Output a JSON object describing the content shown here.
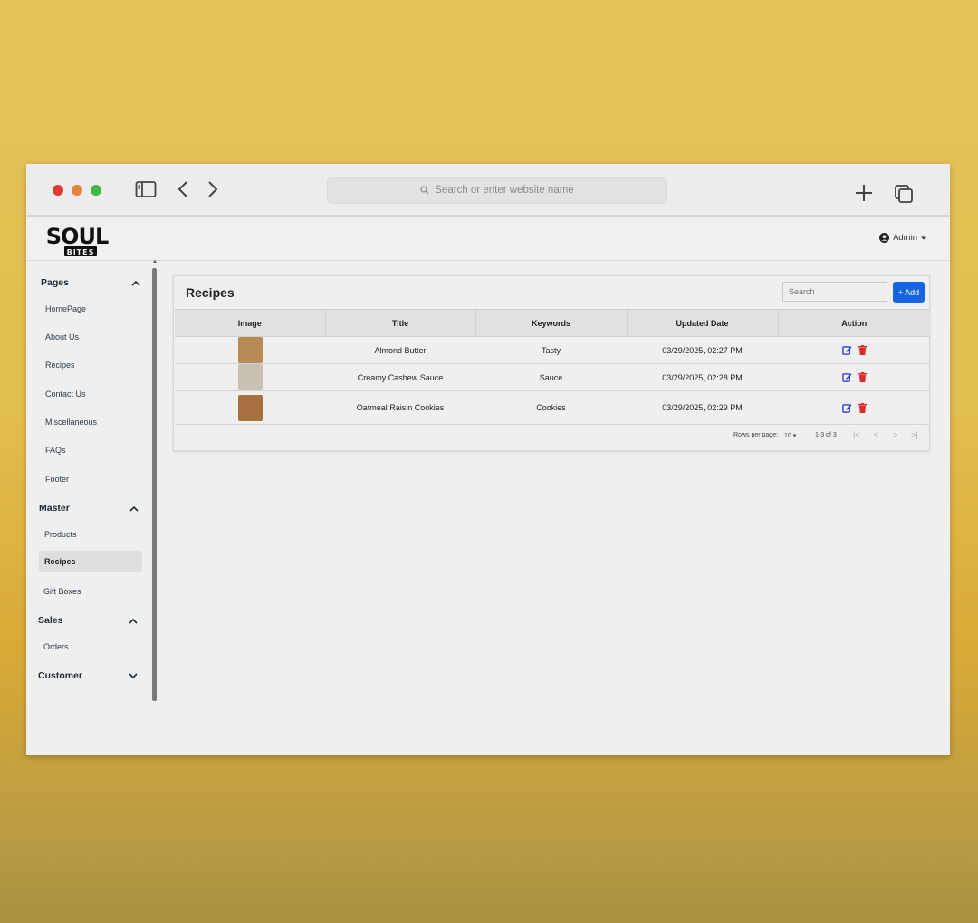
{
  "browser": {
    "address_placeholder": "Search or enter website name"
  },
  "header": {
    "logo_top": "SOUL",
    "logo_bottom": "BITES",
    "user_label": "Admin"
  },
  "sidebar": {
    "sections": [
      {
        "title": "Pages",
        "items": [
          "HomePage",
          "About Us",
          "Recipes",
          "Contact Us",
          "Miscellaneous",
          "FAQs",
          "Footer"
        ]
      },
      {
        "title": "Master",
        "items": [
          "Products",
          "Recipes",
          "Gift Boxes"
        ],
        "active": "Recipes"
      },
      {
        "title": "Sales",
        "items": [
          "Orders"
        ]
      },
      {
        "title": "Customer",
        "items": []
      }
    ]
  },
  "recipes": {
    "title": "Recipes",
    "search_placeholder": "Search",
    "add_label": "+ Add",
    "columns": [
      "Image",
      "Title",
      "Keywords",
      "Updated Date",
      "Action"
    ],
    "rows": [
      {
        "title": "Almond Butter",
        "keywords": "Tasty",
        "updated": "03/29/2025, 02:27 PM",
        "thumb_color": "#b88a55"
      },
      {
        "title": "Creamy Cashew Sauce",
        "keywords": "Sauce",
        "updated": "03/29/2025, 02:28 PM",
        "thumb_color": "#c9c2b2"
      },
      {
        "title": "Oatmeal Raisin Cookies",
        "keywords": "Cookies",
        "updated": "03/29/2025, 02:29 PM",
        "thumb_color": "#a8703f"
      }
    ],
    "pagination": {
      "rows_per_page_label": "Rows per page:",
      "rows_per_page_value": "10",
      "range": "1-3 of 3"
    }
  },
  "colors": {
    "accent": "#1565e0",
    "edit_icon": "#1a2fd6",
    "delete_icon": "#e02828"
  }
}
